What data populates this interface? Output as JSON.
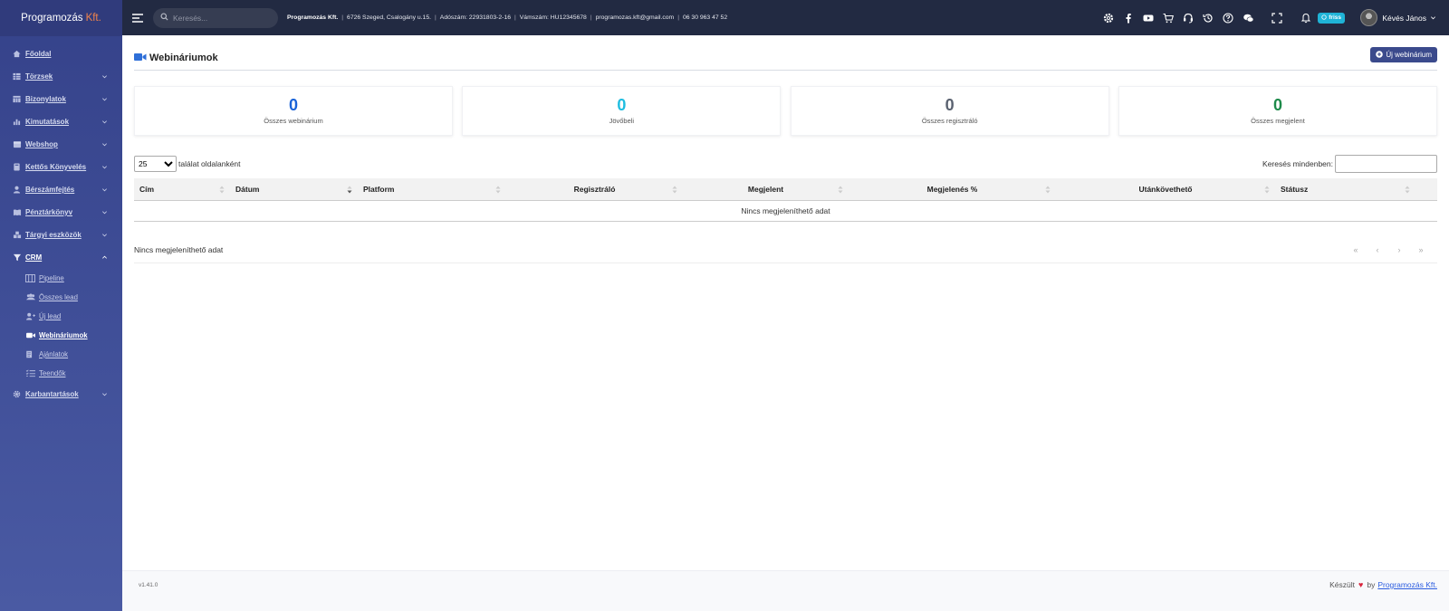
{
  "brand": {
    "name": "Programozás",
    "suffix": "Kft."
  },
  "sidebar": {
    "items": [
      {
        "label": "Főoldal"
      },
      {
        "label": "Törzsek"
      },
      {
        "label": "Bizonylatok"
      },
      {
        "label": "Kimutatások"
      },
      {
        "label": "Webshop"
      },
      {
        "label": "Kettős Könyvelés"
      },
      {
        "label": "Bérszámfejtés"
      },
      {
        "label": "Pénztárkönyv"
      },
      {
        "label": "Tárgyi eszközök"
      },
      {
        "label": "CRM"
      },
      {
        "label": "Karbantartások"
      }
    ],
    "crm_sub": [
      {
        "label": "Pipeline"
      },
      {
        "label": "Összes lead"
      },
      {
        "label": "Új lead"
      },
      {
        "label": "Webináriumok"
      },
      {
        "label": "Ajánlatok"
      },
      {
        "label": "Teendők"
      }
    ]
  },
  "topbar": {
    "search_placeholder": "Keresés...",
    "company_name": "Programozás Kft.",
    "address": "6726 Szeged, Csalogány u.15.",
    "tax": "Adószám: 22931803-2-16",
    "vat": "Vámszám: HU12345678",
    "email": "programozas.kft@gmail.com",
    "phone": "06 30 963 47 52",
    "badge": "friss",
    "user": "Kévés János"
  },
  "page": {
    "title": "Webináriumok",
    "new_button": "Új webinárium",
    "accent": "#3b4a8c"
  },
  "stats": [
    {
      "value": "0",
      "label": "Összes webinárium",
      "color": "#1a63d8"
    },
    {
      "value": "0",
      "label": "Jövőbeli",
      "color": "#1fbde0"
    },
    {
      "value": "0",
      "label": "Összes regisztráló",
      "color": "#5a6270"
    },
    {
      "value": "0",
      "label": "Összes megjelent",
      "color": "#1d8a4a"
    }
  ],
  "table": {
    "per_page": "25",
    "per_page_label": "találat oldalanként",
    "search_label": "Keresés mindenben:",
    "headers": [
      "Cím",
      "Dátum",
      "Platform",
      "Regisztráló",
      "Megjelent",
      "Megjelenés %",
      "Utánkövethető",
      "Státusz"
    ],
    "empty": "Nincs megjeleníthető adat",
    "info": "Nincs megjeleníthető adat",
    "pager": [
      "«",
      "‹",
      "›",
      "»"
    ]
  },
  "footer": {
    "version": "v1.41.0",
    "made_prefix": "Készült",
    "made_by": "by",
    "made_link": "Programozás Kft."
  }
}
